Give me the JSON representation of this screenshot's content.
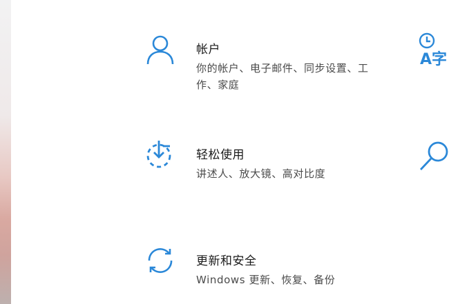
{
  "colors": {
    "accent": "#2b88d8",
    "title": "#1a1a1a",
    "description": "#4a4a4a",
    "background": "#ffffff"
  },
  "settings": [
    {
      "icon": "person-icon",
      "title": "帐户",
      "description": "你的帐户、电子邮件、同步设置、工作、家庭"
    },
    {
      "icon": "ease-of-access-icon",
      "title": "轻松使用",
      "description": "讲述人、放大镜、高对比度"
    },
    {
      "icon": "update-sync-icon",
      "title": "更新和安全",
      "description": "Windows 更新、恢复、备份"
    }
  ],
  "right_column": [
    {
      "icon": "time-language-icon",
      "glyph": "A字"
    },
    {
      "icon": "search-icon"
    }
  ]
}
